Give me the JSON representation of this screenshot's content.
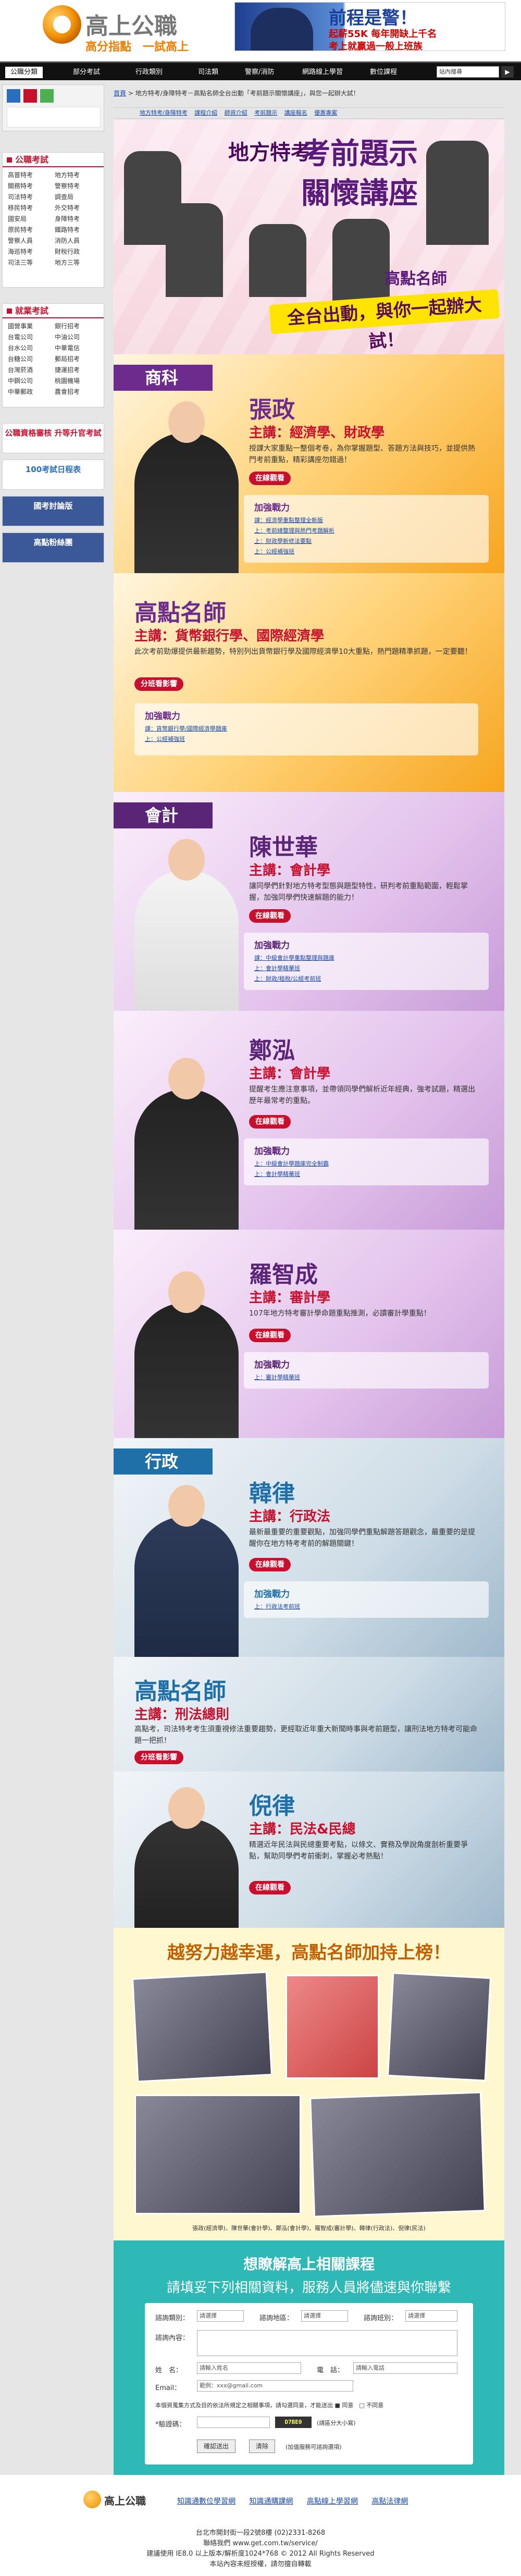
{
  "header": {
    "logo_name": "高上公職",
    "logo_slogan": "高分指點　一試高上",
    "banner_title": "前程是警！",
    "banner_line1": "起薪55K 每年開缺上千名",
    "banner_line2": "考上就贏過一般上班族"
  },
  "nav": {
    "items": [
      "公職分類",
      "部分考試",
      "行政類別",
      "司法類",
      "警察/消防",
      "網路線上學習",
      "數位課程"
    ],
    "search_placeholder": "站內搜尋",
    "search_button": "▶"
  },
  "sidebar": {
    "gov_head": "公職考試",
    "gov_links": [
      "高普特考",
      "地方特考",
      "關務特考",
      "警察特考",
      "司法特考",
      "調查局",
      "移民特考",
      "外交特考",
      "國安局",
      "身障特考",
      "原民特考",
      "鐵路特考",
      "警察人員",
      "消防人員",
      "海巡特考",
      "財稅行政",
      "司法三等",
      "地方三等"
    ],
    "job_head": "就業考試",
    "job_links": [
      "國營事業",
      "銀行招考",
      "台電公司",
      "中油公司",
      "台水公司",
      "中華電信",
      "台糖公司",
      "郵局招考",
      "台灣菸酒",
      "捷運招考",
      "中鋼公司",
      "桃園機場",
      "中華郵政",
      "農會招考"
    ],
    "banner1": "公職資格審核 升等升官考試",
    "banner2": "100考試日程表",
    "banner3": "國考討論版",
    "banner4": "高點粉絲團"
  },
  "breadcrumb": {
    "home": "首頁",
    "sep": " > ",
    "current": "地方特考/身障特考－高點名師全台出動「考前題示關懷講座」，與您一起辦大試！"
  },
  "subnav": {
    "items": [
      "地方特考/身障特考",
      "課程介紹",
      "師資介紹",
      "考前題示",
      "講座報名",
      "優惠專案"
    ]
  },
  "hero": {
    "title_a": "地方特考",
    "title_b": "考前題示",
    "title_c": "關懷講座",
    "brand": "高點名師",
    "slogan": "全台出動，與你一起辦大試！"
  },
  "sections": [
    {
      "tag": "商科",
      "teacher": "張政",
      "subject": "主講：經濟學、財政學",
      "desc": "授課大家重點一整個考卷，為你掌握題型、答題方法與技巧，並提供熱門考前重點，精彩講座勿錯過！",
      "btn": "在線觀看",
      "jq_title": "加強戰力",
      "jq_items": [
        "課：經濟學重點整理全新版",
        "上：考前總整理與熱門考題解析",
        "上：財政學新修法要點",
        "上：公經補強班"
      ]
    },
    {
      "tag": "",
      "teacher": "高點名師",
      "subject": "主講：貨幣銀行學、國際經濟學",
      "desc": "此次考前勁爆提供最新趨勢，特別列出貨幣銀行學及國際經濟學10大重點，熱門題精準抓題，一定要聽！",
      "btn": "分班看影響",
      "jq_title": "加強戰力",
      "jq_items": [
        "課：貨幣銀行學/國際經濟學題庫",
        "上：公經補強班"
      ]
    },
    {
      "tag": "會計",
      "teacher": "陳世華",
      "subject": "主講：會計學",
      "desc": "讓同學們針對地方特考型態與題型特性，研判考前重點範圍，輕鬆掌握，加強同學們快速解題的能力！",
      "btn": "在線觀看",
      "jq_title": "加強戰力",
      "jq_items": [
        "課：中級會計學重點整理與題庫",
        "上：會計學精華班",
        "上：財政/租稅/公經考前班"
      ]
    },
    {
      "tag": "",
      "teacher": "鄭泓",
      "subject": "主講：會計學",
      "desc": "提醒考生應注意事項，並帶領同學們解析近年經典，強考試題，精選出歷年最常考的重點。",
      "btn": "在線觀看",
      "jq_title": "加強戰力",
      "jq_items": [
        "上：中級會計學題庫完全制霸",
        "上：會計學精華班"
      ]
    },
    {
      "tag": "",
      "teacher": "羅智成",
      "subject": "主講：審計學",
      "desc": "107年地方特考審計學命題重點推測，必讀審計學重點！",
      "btn": "在線觀看",
      "jq_title": "加強戰力",
      "jq_items": [
        "上：審計學精華班"
      ]
    },
    {
      "tag": "行政",
      "teacher": "韓律",
      "subject": "主講：行政法",
      "desc": "最新最重要的重要觀點，加強同學們重點解題答題觀念，最重要的是提醒你在地方特考考前的解題關鍵！",
      "btn": "在線觀看",
      "jq_title": "加強戰力",
      "jq_items": [
        "上：行政法考前班"
      ]
    },
    {
      "tag": "",
      "teacher": "高點名師",
      "subject": "主講：刑法總則",
      "desc": "高點考，司法特考考生須重視修法重要趨勢，更經取近年重大新聞時事與考前題型，讓刑法地方特考可能命題一把抓！",
      "btn": "分班看影響",
      "jq_title": "",
      "jq_items": []
    },
    {
      "tag": "",
      "teacher": "倪律",
      "subject": "主講：民法&民總",
      "desc": "精選近年民法與民總重要考點，以條文、實務及學說角度剖析重要爭點，幫助同學們考前衝刺，掌握必考熱點！",
      "btn": "在線觀看",
      "jq_title": "",
      "jq_items": []
    }
  ],
  "celebrate": {
    "title": "越努力越幸運，高點名師加持上榜！",
    "caption": "張政(經濟學)、陳世華(會計學)、鄭泓(會計學)、羅智成(審計學)、韓律(行政法)、倪律(民法)"
  },
  "form": {
    "title": "想瞭解高上相關課程",
    "sub": "請填妥下列相關資料，服務人員將儘速與你聯繫",
    "lab_type": "諮詢類別：",
    "lab_area": "諮詢地區：",
    "lab_branch": "諮詢班別：",
    "sel_type": "請選擇",
    "sel_area": "請選擇",
    "sel_branch": "請選擇",
    "lab_content": "諮詢內容：",
    "lab_name": "姓　名：",
    "lab_phone": "電　話：",
    "lab_email": "Email：",
    "ph_name": "請輸入姓名",
    "ph_phone": "請輸入電話",
    "ph_email": "範例：xxx@gmail.com",
    "privacy": "本個資蒐集方式及目的依法所規定之相關事項，請勾選同意，才能送出 ■ 同意　□ 不同意",
    "lab_code": "*驗證碼：",
    "code": "D7BE0",
    "code_tip": "(請區分大小寫)",
    "submit": "確認送出",
    "reset": "清除",
    "note": "(加值服務可諮詢選項)"
  },
  "footer": {
    "logo": "高上公職",
    "links": [
      "知識通數位學習網",
      "知識通購課網",
      "高點線上學習網",
      "高點法律網"
    ],
    "address": "台北市開封街一段2號8樓 (02)2331-8268",
    "url": "聯絡我們 www.get.com.tw/service/",
    "copyright": "建議使用 IE8.0 以上版本/解析度1024*768 © 2012 All Rights Reserved",
    "tip": "本站內容未經授權，請勿擅自轉載"
  },
  "colors": {
    "accent": "#c8102e",
    "orange": "#ef7d00",
    "purple": "#6d2b8e",
    "teal": "#2fb9b6",
    "blue": "#1f6fa8"
  }
}
